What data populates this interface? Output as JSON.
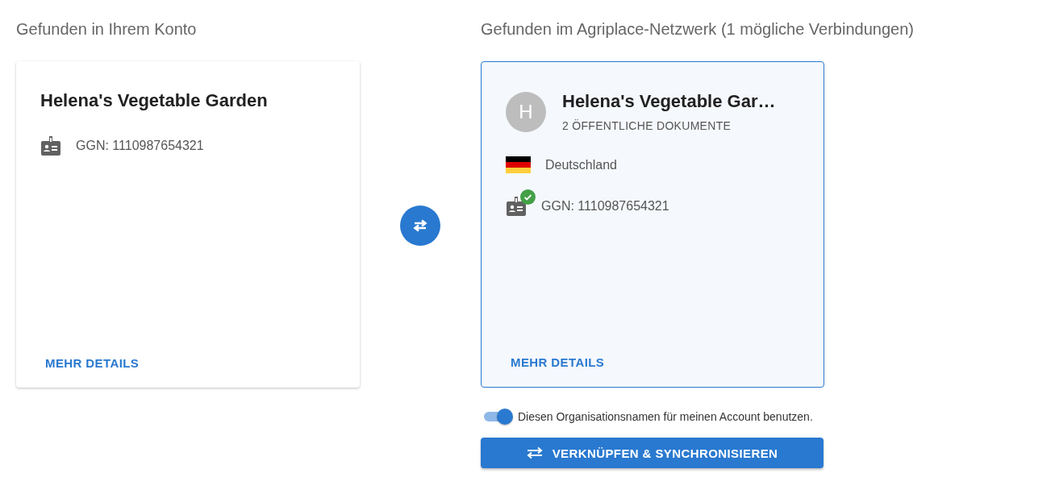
{
  "columns": [
    {
      "heading": "Gefunden in Ihrem Konto",
      "card": {
        "selected": false,
        "name": "Helena's Vegetable Garden",
        "facts": [
          {
            "kind": "id",
            "text": "GGN: 1110987654321",
            "verified": false
          }
        ],
        "link": "MEHR DETAILS"
      }
    },
    {
      "heading": "Gefunden im Agriplace-Netzwerk (1 mögliche Verbindungen)",
      "card": {
        "selected": true,
        "name": "Helena's Vegetable Gar…",
        "avatar": "H",
        "subtitle": "2 ÖFFENTLICHE DOKUMENTE",
        "facts": [
          {
            "kind": "flag",
            "text": "Deutschland"
          },
          {
            "kind": "id",
            "text": "GGN: 1110987654321",
            "verified": true
          }
        ],
        "link": "MEHR DETAILS"
      }
    }
  ],
  "toggle": {
    "on": true,
    "label": "Diesen Organisationsnamen für meinen Account benutzen."
  },
  "action_button": "VERKNÜPFEN & SYNCHRONISIEREN"
}
